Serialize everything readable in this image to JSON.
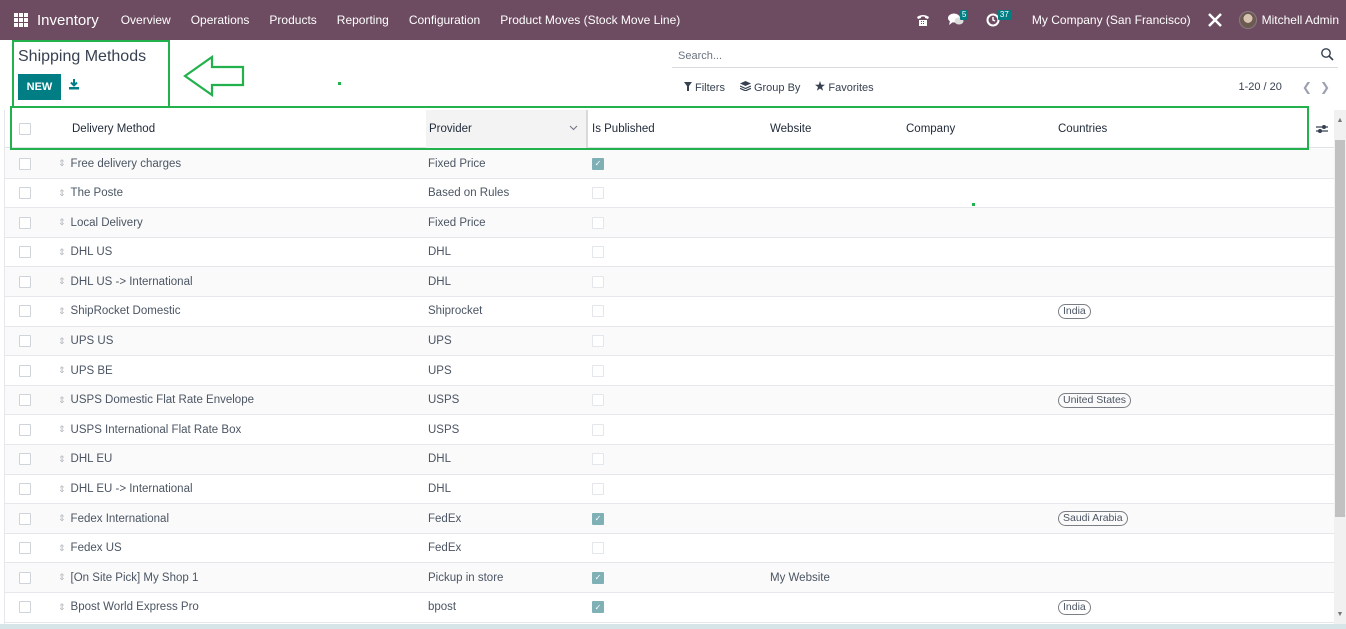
{
  "navbar": {
    "app_name": "Inventory",
    "menu": [
      "Overview",
      "Operations",
      "Products",
      "Reporting",
      "Configuration",
      "Product Moves (Stock Move Line)"
    ],
    "messages_count": "5",
    "activities_count": "37",
    "company": "My Company (San Francisco)",
    "user": "Mitchell Admin",
    "accent_color": "#6d4c61"
  },
  "control_panel": {
    "title": "Shipping Methods",
    "new_label": "NEW",
    "search_placeholder": "Search...",
    "filters_label": "Filters",
    "group_by_label": "Group By",
    "favorites_label": "Favorites",
    "pager": "1-20 / 20",
    "primary_color": "#017e84"
  },
  "table": {
    "columns": {
      "delivery_method": "Delivery Method",
      "provider": "Provider",
      "is_published": "Is Published",
      "website": "Website",
      "company": "Company",
      "countries": "Countries"
    },
    "rows": [
      {
        "name": "Free delivery charges",
        "provider": "Fixed Price",
        "published": true,
        "website": "",
        "company": "",
        "countries": ""
      },
      {
        "name": "The Poste",
        "provider": "Based on Rules",
        "published": false,
        "website": "",
        "company": "",
        "countries": ""
      },
      {
        "name": "Local Delivery",
        "provider": "Fixed Price",
        "published": false,
        "website": "",
        "company": "",
        "countries": ""
      },
      {
        "name": "DHL US",
        "provider": "DHL",
        "published": false,
        "website": "",
        "company": "",
        "countries": ""
      },
      {
        "name": "DHL US -> International",
        "provider": "DHL",
        "published": false,
        "website": "",
        "company": "",
        "countries": ""
      },
      {
        "name": "ShipRocket Domestic",
        "provider": "Shiprocket",
        "published": false,
        "website": "",
        "company": "",
        "countries": "India"
      },
      {
        "name": "UPS US",
        "provider": "UPS",
        "published": false,
        "website": "",
        "company": "",
        "countries": ""
      },
      {
        "name": "UPS BE",
        "provider": "UPS",
        "published": false,
        "website": "",
        "company": "",
        "countries": ""
      },
      {
        "name": "USPS Domestic Flat Rate Envelope",
        "provider": "USPS",
        "published": false,
        "website": "",
        "company": "",
        "countries": "United States"
      },
      {
        "name": "USPS International Flat Rate Box",
        "provider": "USPS",
        "published": false,
        "website": "",
        "company": "",
        "countries": ""
      },
      {
        "name": "DHL EU",
        "provider": "DHL",
        "published": false,
        "website": "",
        "company": "",
        "countries": ""
      },
      {
        "name": "DHL EU -> International",
        "provider": "DHL",
        "published": false,
        "website": "",
        "company": "",
        "countries": ""
      },
      {
        "name": "Fedex International",
        "provider": "FedEx",
        "published": true,
        "website": "",
        "company": "",
        "countries": "Saudi Arabia"
      },
      {
        "name": "Fedex US",
        "provider": "FedEx",
        "published": false,
        "website": "",
        "company": "",
        "countries": ""
      },
      {
        "name": "[On Site Pick] My Shop 1",
        "provider": "Pickup in store",
        "published": true,
        "website": "My Website",
        "company": "",
        "countries": ""
      },
      {
        "name": "Bpost World Express Pro",
        "provider": "bpost",
        "published": true,
        "website": "",
        "company": "",
        "countries": "India"
      }
    ]
  },
  "annotation_color": "#22b14c"
}
